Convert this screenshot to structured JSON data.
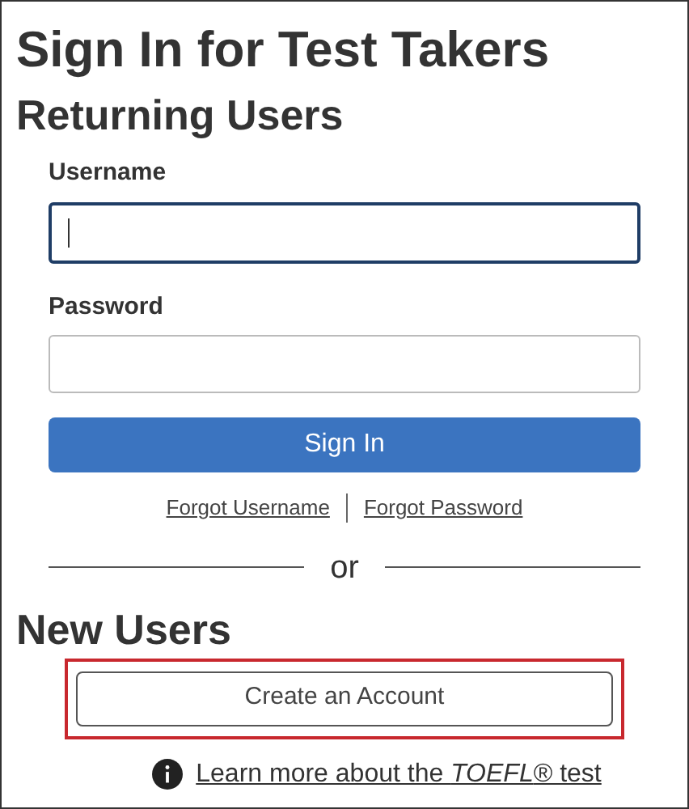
{
  "title": "Sign In for Test Takers",
  "returning": {
    "heading": "Returning Users",
    "fields": [
      {
        "label": "Username",
        "focused": true
      },
      {
        "label": "Password",
        "focused": false
      }
    ],
    "submit": "Sign In",
    "links": [
      "Forgot Username",
      "Forgot Password"
    ],
    "separator": "or"
  },
  "new_users": {
    "heading": "New Users",
    "button": "Create an Account",
    "highlighted": true
  },
  "info_link": "Learn more about the *TOEFL*® test"
}
